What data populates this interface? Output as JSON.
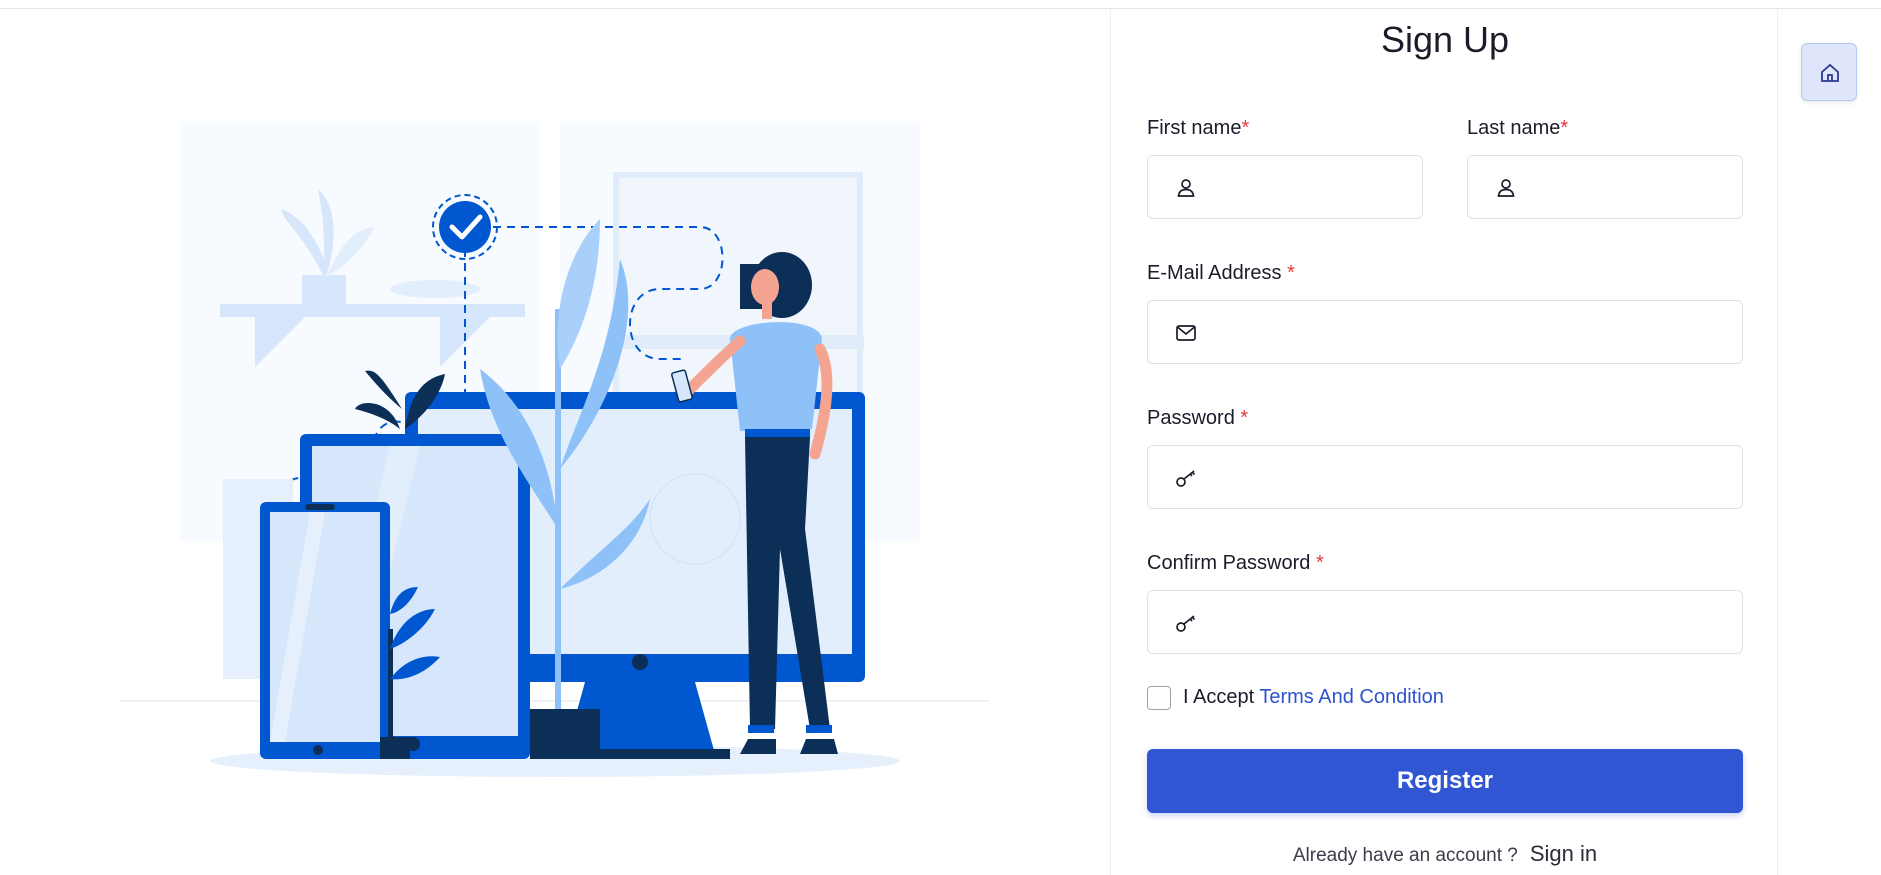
{
  "form": {
    "title": "Sign Up",
    "first_name_label": "First name",
    "last_name_label": "Last name",
    "email_label": "E-Mail Address ",
    "password_label": "Password ",
    "confirm_label": "Confirm Password ",
    "required_mark": "*",
    "first_name_value": "",
    "last_name_value": "",
    "email_value": "",
    "password_value": "",
    "confirm_value": "",
    "accept_text": "I Accept ",
    "terms_link": "Terms And Condition",
    "register_label": "Register",
    "already_text": "Already have an account ?",
    "signin_link": "Sign in"
  },
  "icons": {
    "first_name": "user-icon",
    "last_name": "user-icon",
    "email": "mail-icon",
    "password": "key-icon",
    "confirm": "key-icon",
    "home": "home-icon"
  },
  "colors": {
    "primary": "#3056d3",
    "required": "#e03a3a",
    "illustration_blue": "#0057d0",
    "illustration_navy": "#0b2f57",
    "illustration_light": "#d7e7fb"
  }
}
